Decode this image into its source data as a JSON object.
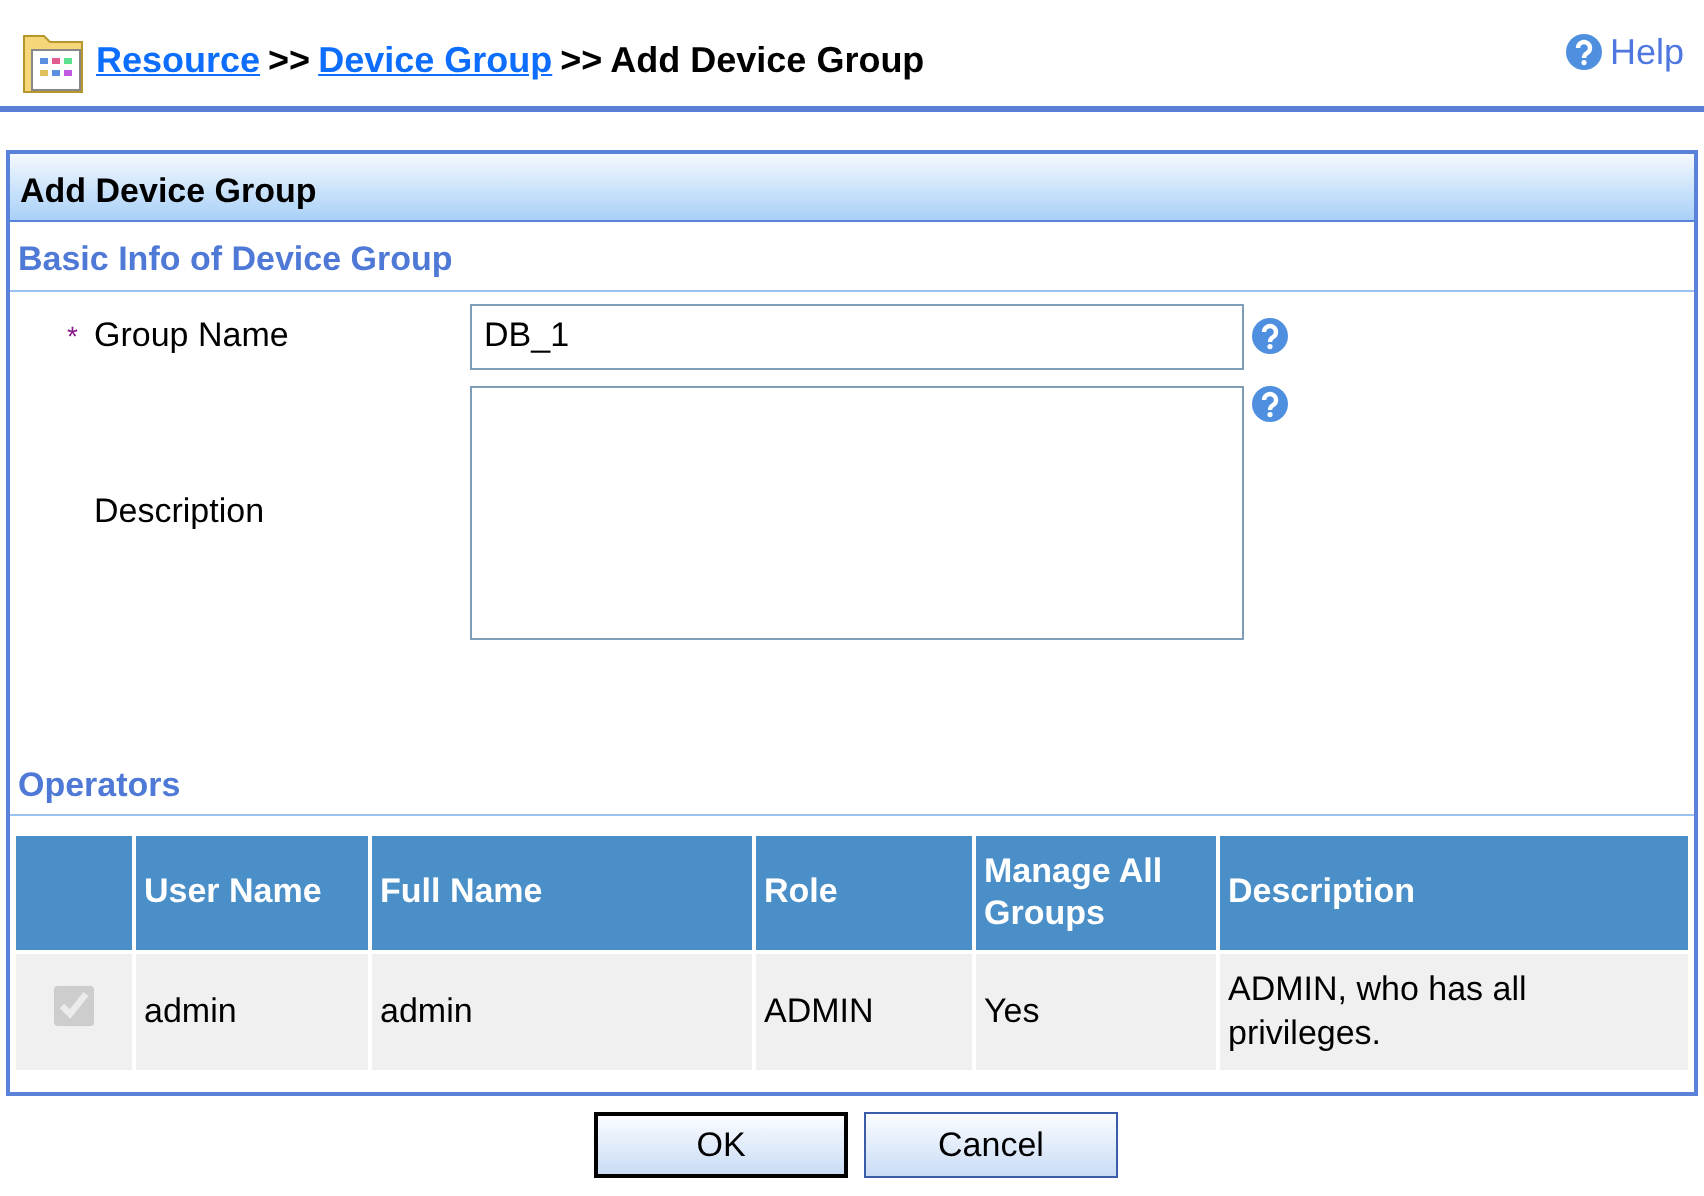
{
  "breadcrumb": [
    {
      "label": "Resource",
      "link": true
    },
    {
      "label": ">>",
      "link": false
    },
    {
      "label": "Device Group",
      "link": true
    },
    {
      "label": ">>",
      "link": false
    },
    {
      "label": "Add Device Group",
      "link": false
    }
  ],
  "help": "Help",
  "panel": {
    "title": "Add Device Group",
    "basic_section": "Basic Info of Device Group",
    "fields": [
      {
        "kind": "input",
        "required_mark": "*",
        "label": "Group Name",
        "value": "DB_1"
      },
      {
        "kind": "textarea",
        "label": "Description"
      }
    ],
    "operators_section": "Operators",
    "table": {
      "columns": [
        "User Name",
        "Full Name",
        "Role",
        "Manage All Groups",
        "Description"
      ],
      "rows": [
        {
          "checked": true,
          "disabled": true,
          "cells": [
            "admin",
            "admin",
            "ADMIN",
            "Yes",
            "ADMIN, who has all privileges."
          ]
        }
      ]
    }
  },
  "buttons": [
    "OK",
    "Cancel"
  ]
}
